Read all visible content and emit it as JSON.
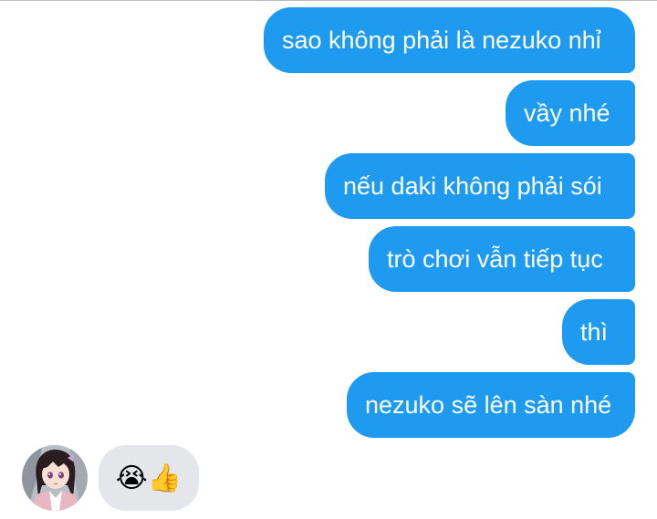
{
  "messages_outgoing": [
    "sao không phải là nezuko nhỉ",
    "vầy nhé",
    "nếu daki không phải sói",
    "trò chơi vẫn tiếp tục",
    "thì",
    "nezuko sẽ lên sàn nhé"
  ],
  "incoming_reply": {
    "emoji_1": "😭",
    "emoji_2": "👍",
    "avatar_icon": "anime-girl-avatar-icon"
  },
  "colors": {
    "outgoing_bubble": "#1e9bf0",
    "incoming_bubble": "#e4e6ea",
    "background": "#ffffff"
  }
}
